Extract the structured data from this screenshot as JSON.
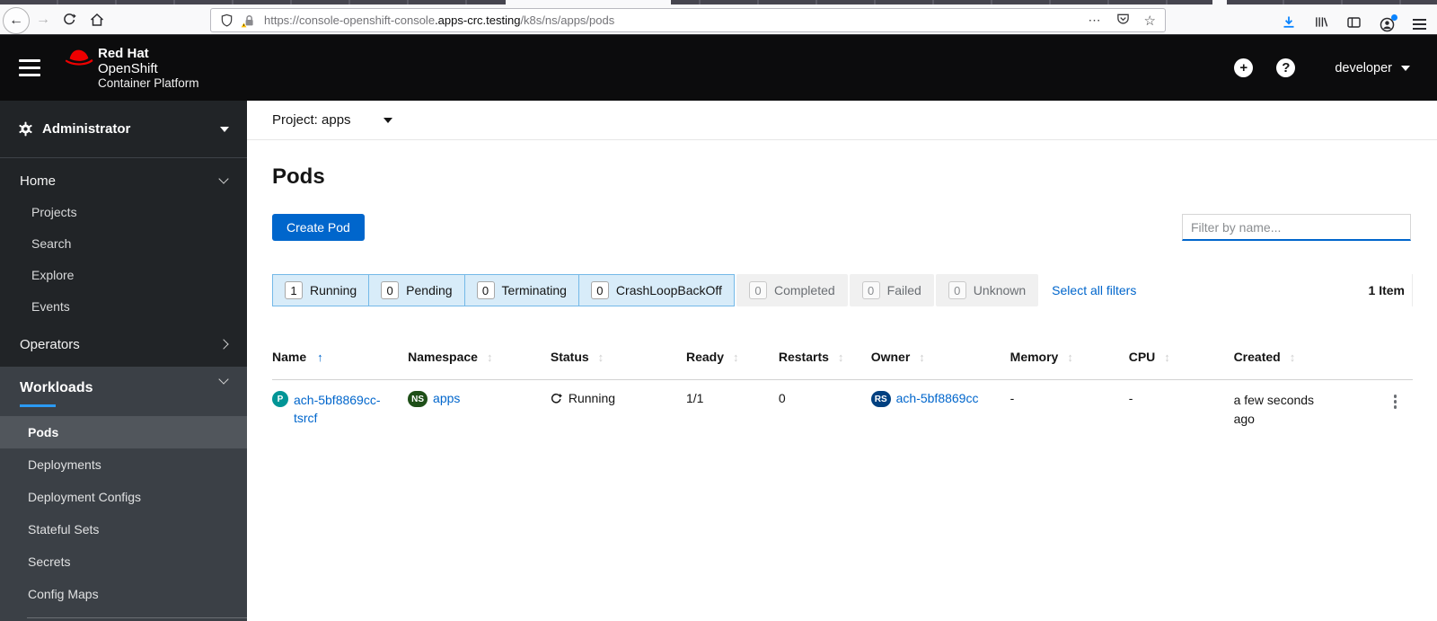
{
  "browser": {
    "url": {
      "scheme_part": "https://console-openshift-console",
      "host_part": ".apps-crc.testing",
      "path_part": "/k8s/ns/apps/pods"
    }
  },
  "icons": {
    "back": "←",
    "forward": "→",
    "ellipsis": "⋯",
    "star": "☆",
    "plus": "+",
    "question": "?",
    "sort_asc": "↑",
    "sort_both": "↕"
  },
  "masthead": {
    "brand_line1": "Red Hat",
    "brand_line2": "OpenShift",
    "brand_line3": "Container Platform",
    "username": "developer"
  },
  "sidebar": {
    "perspective": "Administrator",
    "groups": [
      {
        "label": "Home",
        "expanded": true,
        "items": [
          "Projects",
          "Search",
          "Explore",
          "Events"
        ]
      },
      {
        "label": "Operators",
        "expanded": false
      },
      {
        "label": "Workloads",
        "expanded": true,
        "active_item": "Pods",
        "items": [
          "Pods",
          "Deployments",
          "Deployment Configs",
          "Stateful Sets",
          "Secrets",
          "Config Maps"
        ]
      }
    ]
  },
  "project_bar": {
    "label": "Project: apps"
  },
  "page": {
    "title": "Pods",
    "create_button": "Create Pod",
    "filter_placeholder": "Filter by name..."
  },
  "filter_bar": {
    "selected": [
      {
        "count": "1",
        "label": "Running"
      },
      {
        "count": "0",
        "label": "Pending"
      },
      {
        "count": "0",
        "label": "Terminating"
      },
      {
        "count": "0",
        "label": "CrashLoopBackOff"
      }
    ],
    "unselected": [
      {
        "count": "0",
        "label": "Completed"
      },
      {
        "count": "0",
        "label": "Failed"
      },
      {
        "count": "0",
        "label": "Unknown"
      }
    ],
    "select_all": "Select all filters",
    "item_count": "1 Item"
  },
  "table": {
    "columns": [
      "Name",
      "Namespace",
      "Status",
      "Ready",
      "Restarts",
      "Owner",
      "Memory",
      "CPU",
      "Created"
    ],
    "sorted_column": "Name",
    "rows": [
      {
        "name_badge": "P",
        "name": "ach-5bf8869cc-tsrcf",
        "namespace_badge": "NS",
        "namespace": "apps",
        "status": "Running",
        "ready": "1/1",
        "restarts": "0",
        "owner_badge": "RS",
        "owner": "ach-5bf8869cc",
        "memory": "-",
        "cpu": "-",
        "created": "a few seconds ago"
      }
    ]
  },
  "colors": {
    "primary": "#0066cc",
    "link": "#0066cc",
    "masthead_bg": "#0c0c0d",
    "sidebar_bg": "#212427",
    "sidebar_section_bg": "#3b4046",
    "sidebar_active_bg": "#51565c",
    "active_nav_indicator": "#2b9af3",
    "selected_filter_bg": "#d8ecf9",
    "selected_filter_border": "#74b9e8",
    "pod_badge": "#009596",
    "namespace_badge": "#1e4f18",
    "replicaset_badge": "#004080",
    "download_icon": "#0a84ff",
    "redhat_red": "#ee0000"
  }
}
